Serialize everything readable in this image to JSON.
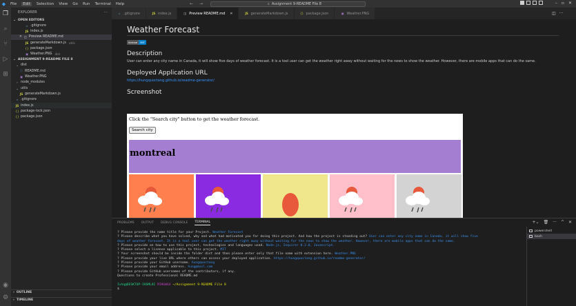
{
  "titlebar": {
    "menu": [
      "File",
      "Edit",
      "Selection",
      "View",
      "Go",
      "Run",
      "Terminal",
      "Help"
    ],
    "search": "Assignment 9-README File 8"
  },
  "sidebar": {
    "header": "EXPLORER",
    "open_editors_label": "OPEN EDITORS",
    "open_editors": [
      {
        "icon": "git",
        "label": ".gitignore",
        "note": ""
      },
      {
        "icon": "js",
        "label": "index.js",
        "note": ""
      },
      {
        "icon": "prev",
        "label": "Preview README.md",
        "note": ""
      },
      {
        "icon": "js",
        "label": "generateMarkdown.js",
        "note": "utils"
      },
      {
        "icon": "json",
        "label": "package.json",
        "note": ""
      },
      {
        "icon": "img",
        "label": "Weather.PNG",
        "note": "dist"
      }
    ],
    "project_label": "ASSIGNMENT 9-README FILE 8",
    "tree": [
      {
        "icon": "folder",
        "label": "dist",
        "indent": 0
      },
      {
        "icon": "md",
        "label": "README.md",
        "indent": 1
      },
      {
        "icon": "img",
        "label": "Weather.PNG",
        "indent": 1
      },
      {
        "icon": "folder-closed",
        "label": "node_modules",
        "indent": 0
      },
      {
        "icon": "folder",
        "label": "utils",
        "indent": 0
      },
      {
        "icon": "js",
        "label": "generateMarkdown.js",
        "indent": 1
      },
      {
        "icon": "git",
        "label": ".gitignore",
        "indent": 0
      },
      {
        "icon": "js",
        "label": "index.js",
        "indent": 0
      },
      {
        "icon": "json",
        "label": "package-lock.json",
        "indent": 0
      },
      {
        "icon": "json",
        "label": "package.json",
        "indent": 0
      }
    ],
    "outline": "OUTLINE",
    "timeline": "TIMELINE"
  },
  "tabs": [
    {
      "icon": "git",
      "label": ".gitignore",
      "active": false
    },
    {
      "icon": "js",
      "label": "index.js",
      "active": false
    },
    {
      "icon": "prev",
      "label": "Preview README.md",
      "active": true
    },
    {
      "icon": "js",
      "label": "generateMarkdown.js",
      "active": false
    },
    {
      "icon": "json",
      "label": "package.json",
      "active": false
    },
    {
      "icon": "img",
      "label": "Weather.PNG",
      "active": false
    }
  ],
  "preview": {
    "title": "Weather Forecast",
    "badge_label": "license",
    "badge_value": "MIT",
    "description_heading": "Description",
    "description": "User can enter any city name in Canada, it will show five days of weather forecast. It is a tool user can get the weather right away without waiting for the news to show the weather. However, there are mobile apps that can do the same.",
    "deployed_heading": "Deployed Application URL",
    "deployed_url": "https://hungquoctang.github.io/readme-generator/",
    "screenshot_heading": "Screenshot",
    "screenshot": {
      "message": "Click the \"Search city\" button to get the weather forecast.",
      "button": "Search city",
      "city": "montreal",
      "day_colors": [
        "#ff7f4f",
        "#8a2be2",
        "#f0e68c",
        "#ffc0cb",
        "#d3d3d3"
      ]
    }
  },
  "panel": {
    "tabs": [
      "PROBLEMS",
      "OUTPUT",
      "DEBUG CONSOLE",
      "TERMINAL"
    ],
    "active_tab": "TERMINAL",
    "terminals": [
      "powershell",
      "bash"
    ],
    "lines": [
      {
        "q": "? Please provide the name title for your Project.",
        "a": "Weather Forecast"
      },
      {
        "q": "? Please describe what you have solved, why and what had motivated you for doing this project.  And how the project is standing out?",
        "a": "User can enter any city name in Canada, it will show five"
      },
      {
        "q": "",
        "a": "days of weather forecast. It is a tool user can get the weather right away without waiting for the news to show the weather.  However, there are mobile apps that can do the same."
      },
      {
        "q": "? Please provide on how to use this project, technologies and languages used.",
        "a": "Node.js, Inquirer 8.2.0, Javascript."
      },
      {
        "q": "? Please select a license applicable to this project.",
        "a": "MIT"
      },
      {
        "q": "? Your screenshot should be inside the folder dist and then please enter only that file name with extension here.",
        "a": "Weather.PNG"
      },
      {
        "q": "? Please provide your live URL where others can access your deployed application.",
        "a": "https://hungquoctang.github.io/readme-generator/"
      },
      {
        "q": "? Please provide your GitHub username.",
        "a": "hungquoctang"
      },
      {
        "q": "? Please provide your email address.",
        "a": "hung@mail.com"
      },
      {
        "q": "? Please provide GitHub usernames of the contributors, if any.",
        "a": ""
      },
      {
        "q": "Questions to create Professional README.md",
        "a": ""
      }
    ],
    "prompt_user": "Ivhq@DESKTOP-IHSML8I",
    "prompt_host": "MINGW64",
    "prompt_path": "~/Assignment 9-README File 8",
    "prompt_symbol": "$"
  }
}
